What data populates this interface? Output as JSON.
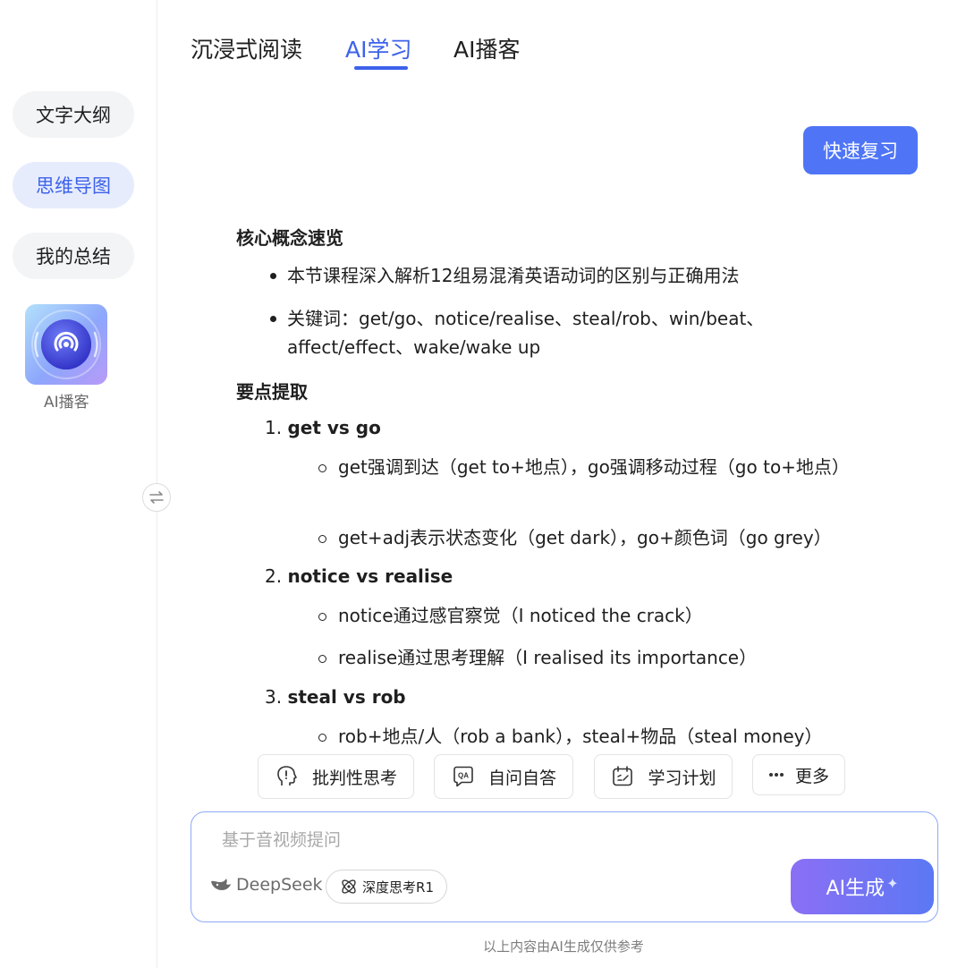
{
  "tabs": [
    {
      "label": "沉浸式阅读"
    },
    {
      "label": "AI学习"
    },
    {
      "label": "AI播客"
    }
  ],
  "sidebar": {
    "items": [
      {
        "label": "文字大纲"
      },
      {
        "label": "思维导图"
      },
      {
        "label": "我的总结"
      }
    ],
    "podcast_label": "AI播客"
  },
  "quick_review_label": "快速复习",
  "content": {
    "section1_title": "核心概念速览",
    "bullets": [
      "本节课程深入解析12组易混淆英语动词的区别与正确用法",
      "关键词：get/go、notice/realise、steal/rob、win/beat、affect/effect、wake/wake up"
    ],
    "section2_title": "要点提取",
    "items": [
      {
        "num": "1.",
        "title": "get vs go",
        "subs": [
          "get强调到达（get to+地点），go强调移动过程（go to+地点）",
          "get+adj表示状态变化（get dark），go+颜色词（go grey）"
        ]
      },
      {
        "num": "2.",
        "title": "notice vs realise",
        "subs": [
          "notice通过感官察觉（I noticed the crack）",
          "realise通过思考理解（I realised its importance）"
        ]
      },
      {
        "num": "3.",
        "title": "steal vs rob",
        "subs": [
          "rob+地点/人（rob a bank），steal+物品（steal money）"
        ]
      }
    ]
  },
  "actions": [
    {
      "label": "批判性思考"
    },
    {
      "label": "自问自答"
    },
    {
      "label": "学习计划"
    },
    {
      "label": "更多"
    }
  ],
  "input": {
    "placeholder": "基于音视频提问",
    "model_name": "DeepSeek",
    "deep_think_label": "深度思考R1",
    "generate_label": "AI生成",
    "spark": "✦"
  },
  "footer_note": "以上内容由AI生成仅供参考",
  "colors": {
    "accent": "#3d62ea",
    "primary_button": "#4f75f6",
    "gradient_start": "#8b6ff5",
    "gradient_end": "#5b78f4"
  }
}
